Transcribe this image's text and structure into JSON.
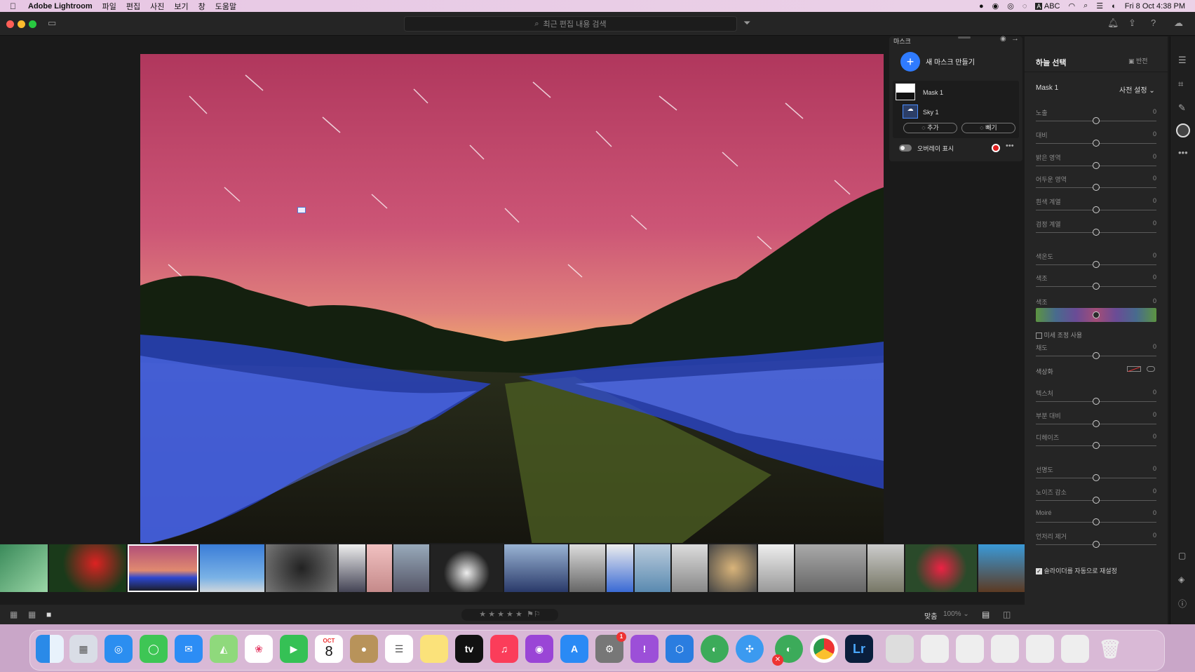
{
  "menubar": {
    "app_name": "Adobe Lightroom",
    "menus": [
      "파일",
      "편집",
      "사진",
      "보기",
      "창",
      "도움말"
    ],
    "input_source": "ABC",
    "clock": "Fri 8 Oct  4:38 PM"
  },
  "toolbar": {
    "search_placeholder": "최근 편집 내용 검색"
  },
  "mask_panel": {
    "title": "마스크",
    "create_label": "새 마스크 만들기",
    "masks": [
      {
        "name": "Mask 1"
      },
      {
        "name": "Sky 1"
      }
    ],
    "add_label": "추가",
    "subtract_label": "빼기",
    "overlay_label": "오버레이 표시",
    "overlay_color": "#e02020"
  },
  "right_panel": {
    "title": "하늘 선택",
    "invert_label": "반전",
    "mask_name": "Mask 1",
    "preset_label": "사전 설정",
    "sliders_group1": [
      {
        "label": "노출",
        "value": "0"
      },
      {
        "label": "대비",
        "value": "0"
      },
      {
        "label": "밝은 영역",
        "value": "0"
      },
      {
        "label": "어두운 영역",
        "value": "0"
      },
      {
        "label": "흰색 계열",
        "value": "0"
      },
      {
        "label": "검정 계열",
        "value": "0"
      }
    ],
    "sliders_group2": [
      {
        "label": "색온도",
        "value": "0"
      },
      {
        "label": "색조",
        "value": "0"
      }
    ],
    "hue": {
      "label": "색조",
      "value": "0"
    },
    "fine_adjust_label": "미세 조정 사용",
    "saturation": {
      "label": "채도",
      "value": "0"
    },
    "colorize_label": "색상화",
    "sliders_group3": [
      {
        "label": "텍스처",
        "value": "0"
      },
      {
        "label": "부분 대비",
        "value": "0"
      },
      {
        "label": "디헤이즈",
        "value": "0"
      }
    ],
    "sliders_group4": [
      {
        "label": "선명도",
        "value": "0"
      },
      {
        "label": "노이즈 감소",
        "value": "0"
      },
      {
        "label": "Moiré",
        "value": "0"
      },
      {
        "label": "언저리 제거",
        "value": "0"
      }
    ],
    "auto_reset_label": "슬라이더를 자동으로 재설정"
  },
  "bottombar": {
    "fit_label": "맞춤",
    "zoom_label": "100%"
  },
  "dock": {
    "calendar_month": "OCT",
    "calendar_day": "8",
    "tv_label": "tv",
    "lr_label": "Lr",
    "settings_badge": "1"
  }
}
